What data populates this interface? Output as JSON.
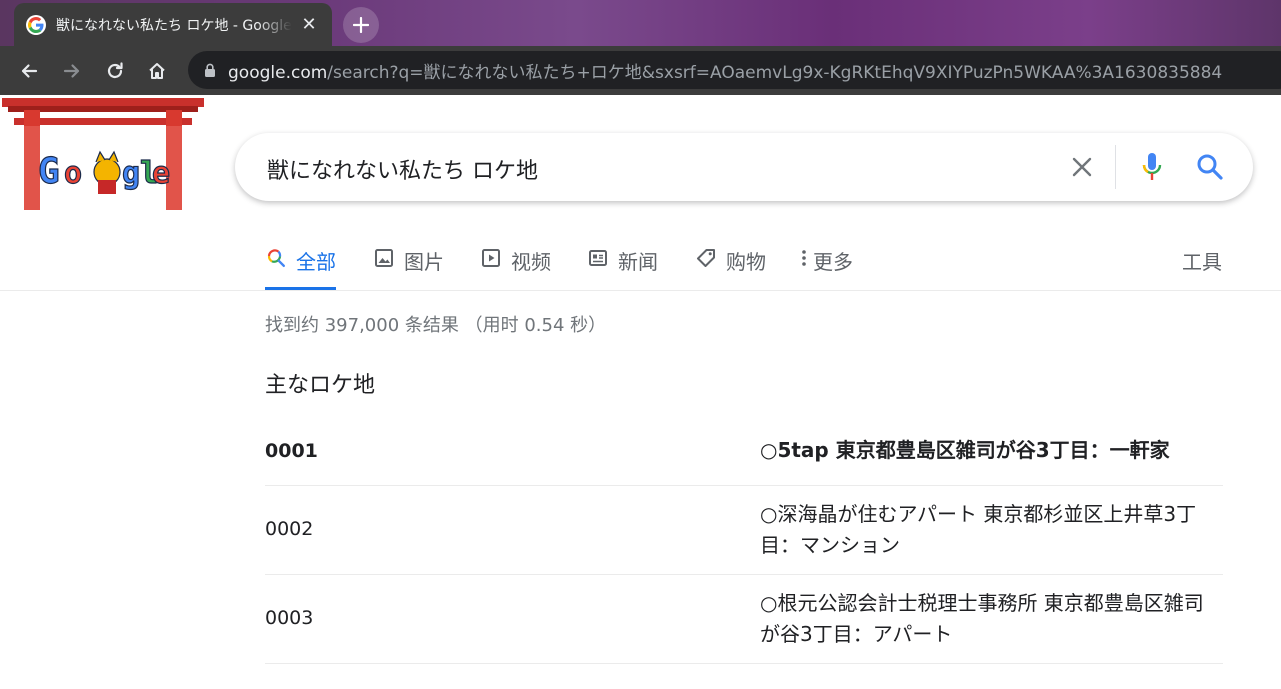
{
  "browser": {
    "tab_title": "獣になれない私たち ロケ地 - Google 検索",
    "tab_close": "✕",
    "url_host": "google.com",
    "url_path": "/search?q=獣になれない私たち+ロケ地&sxsrf=AOaemvLg9x-KgRKtEhqV9XIYPuzPn5WKAA%3A1630835884"
  },
  "search": {
    "query": "獣になれない私たち ロケ地"
  },
  "tabs": [
    {
      "label": "全部",
      "icon": "search-icon"
    },
    {
      "label": "图片",
      "icon": "image-icon"
    },
    {
      "label": "视频",
      "icon": "video-icon"
    },
    {
      "label": "新闻",
      "icon": "news-icon"
    },
    {
      "label": "购物",
      "icon": "tag-icon"
    },
    {
      "label": "更多",
      "icon": "more-vert-icon"
    }
  ],
  "tools_label": "工具",
  "result_stats": "找到约 397,000 条结果 （用时 0.54 秒）",
  "section_title": "主なロケ地",
  "table": {
    "rows": [
      {
        "col1": "0001",
        "col2": "○5tap 東京都豊島区雑司が谷3丁目：一軒家"
      },
      {
        "col1": "0002",
        "col2": "○深海晶が住むアパート 東京都杉並区上井草3丁目：マンション"
      },
      {
        "col1": "0003",
        "col2": "○根元公認会計士税理士事務所 東京都豊島区雑司が谷3丁目：アパート"
      }
    ]
  },
  "colors": {
    "accent": "#1a73e8",
    "chrome_toolbar": "#3c3c3c",
    "omnibox": "#202124"
  }
}
